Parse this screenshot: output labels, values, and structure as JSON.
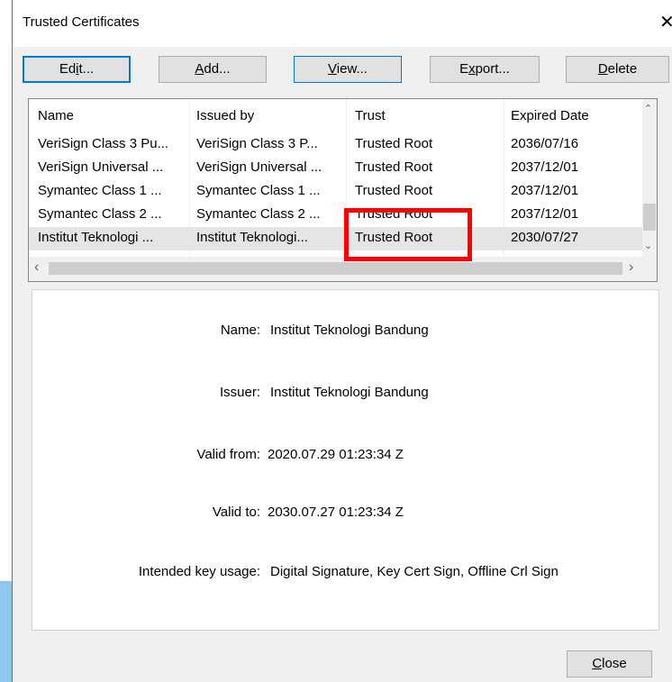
{
  "window": {
    "title": "Trusted Certificates",
    "close_glyph": "✕"
  },
  "toolbar": {
    "edit_pre": "Ed",
    "edit_key": "i",
    "edit_post": "t...",
    "add_key": "A",
    "add_post": "dd...",
    "view_key": "V",
    "view_post": "iew...",
    "export_pre": "E",
    "export_key": "x",
    "export_post": "port...",
    "delete_key": "D",
    "delete_post": "elete"
  },
  "table": {
    "columns": [
      "Name",
      "Issued by",
      "Trust",
      "Expired Date"
    ],
    "rows": [
      [
        "VeriSign Class 3 Pu...",
        "VeriSign Class 3 P...",
        "Trusted Root",
        "2036/07/16"
      ],
      [
        "VeriSign Universal ...",
        "VeriSign Universal ...",
        "Trusted Root",
        "2037/12/01"
      ],
      [
        "Symantec Class 1 ...",
        "Symantec Class 1 ...",
        "Trusted Root",
        "2037/12/01"
      ],
      [
        "Symantec Class 2 ...",
        "Symantec Class 2 ...",
        "Trusted Root",
        "2037/12/01"
      ],
      [
        "Institut Teknologi ...",
        "Institut Teknologi...",
        "Trusted Root",
        "2030/07/27"
      ]
    ],
    "selected_row": 4,
    "scroll_up_glyph": "⌃",
    "scroll_down_glyph": "⌄",
    "scroll_left_glyph": "‹",
    "scroll_right_glyph": "›"
  },
  "details": {
    "name_label": "Name:",
    "name_value": "Institut Teknologi Bandung",
    "issuer_label": "Issuer:",
    "issuer_value": "Institut Teknologi Bandung",
    "valid_from_label": "Valid from:",
    "valid_from_value": "2020.07.29 01:23:34 Z",
    "valid_to_label": "Valid to:",
    "valid_to_value": "2030.07.27 01:23:34 Z",
    "key_usage_label": "Intended key usage:",
    "key_usage_value": "Digital Signature, Key Cert Sign, Offline Crl Sign"
  },
  "footer": {
    "close_key": "C",
    "close_post": "lose"
  },
  "colors": {
    "focus_border": "#0078d7",
    "annotation": "#ff0000",
    "taskbar_blue": "#8fc7ef"
  }
}
